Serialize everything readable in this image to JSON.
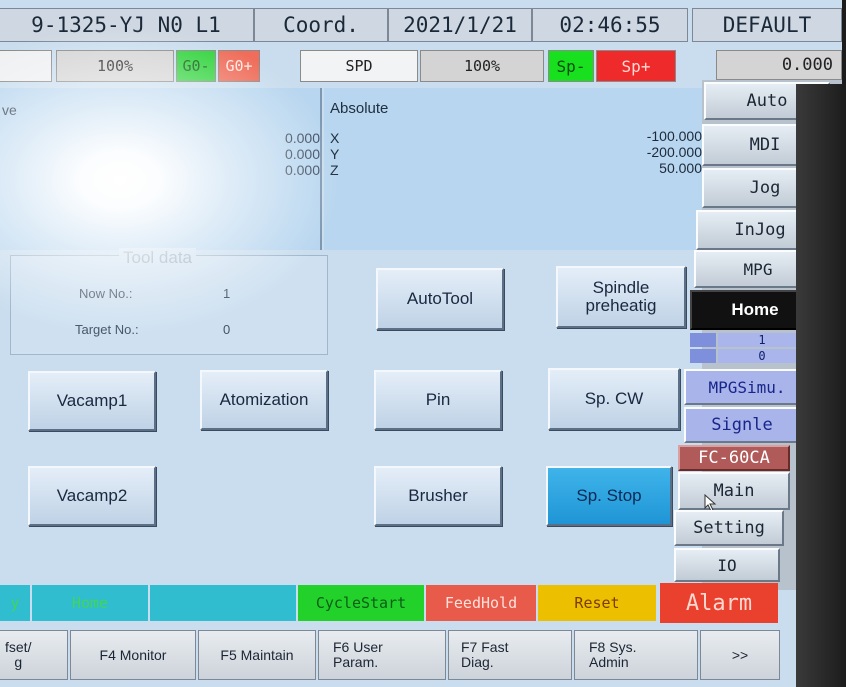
{
  "header": {
    "program": "9-1325-YJ N0 L1",
    "coord": "Coord.",
    "date": "2021/1/21",
    "time": "02:46:55",
    "profile": "DEFAULT"
  },
  "rate_bar": {
    "feed_pct": "100%",
    "g0_minus": "G0-",
    "g0_plus": "G0+",
    "spd_label": "SPD",
    "spd_pct": "100%",
    "sp_minus": "Sp-",
    "sp_plus": "Sp+",
    "value": "0.000"
  },
  "position": {
    "left_title": "ve",
    "left_values": [
      "0.000",
      "0.000",
      "0.000"
    ],
    "axes": [
      "X",
      "Y",
      "Z"
    ],
    "abs_title": "Absolute",
    "abs_values": [
      "-100.000",
      "-200.000",
      "50.000"
    ]
  },
  "tool": {
    "title": "Tool data",
    "now_label": "Now No.:",
    "now_value": "1",
    "target_label": "Target No.:",
    "target_value": "0"
  },
  "buttons": {
    "autotool": "AutoTool",
    "spindle_preheat": "Spindle\npreheatig",
    "vacamp1": "Vacamp1",
    "atomization": "Atomization",
    "pin": "Pin",
    "sp_cw": "Sp. CW",
    "vacamp2": "Vacamp2",
    "brusher": "Brusher",
    "sp_stop": "Sp. Stop"
  },
  "side": {
    "auto": "Auto",
    "mdi": "MDI",
    "jog": "Jog",
    "injog": "InJog",
    "mpg": "MPG",
    "home": "Home",
    "counter_top": "1",
    "counter_bottom": "0",
    "mpgsimu": "MPGSimu.",
    "signle": "Signle",
    "model": "FC-60CA",
    "main": "Main",
    "setting": "Setting",
    "io": "IO"
  },
  "status": {
    "seg1": "y",
    "seg2": "Home",
    "cycle_start": "CycleStart",
    "feed_hold": "FeedHold",
    "reset": "Reset",
    "alarm": "Alarm"
  },
  "fkeys": {
    "f3": "fset/\ng",
    "f4": "F4 Monitor",
    "f5": "F5 Maintain",
    "f6": "F6 User\nParam.",
    "f7": "F7 Fast\nDiag.",
    "f8": "F8 Sys.\nAdmin",
    "more": ">>"
  },
  "colors": {
    "green": "#26c22a",
    "red_btn": "#e84a3c",
    "orange": "#ecc000",
    "alarm": "#e8402e",
    "sp_stop": "#27a3e0",
    "cyan": "#33b7c9"
  }
}
